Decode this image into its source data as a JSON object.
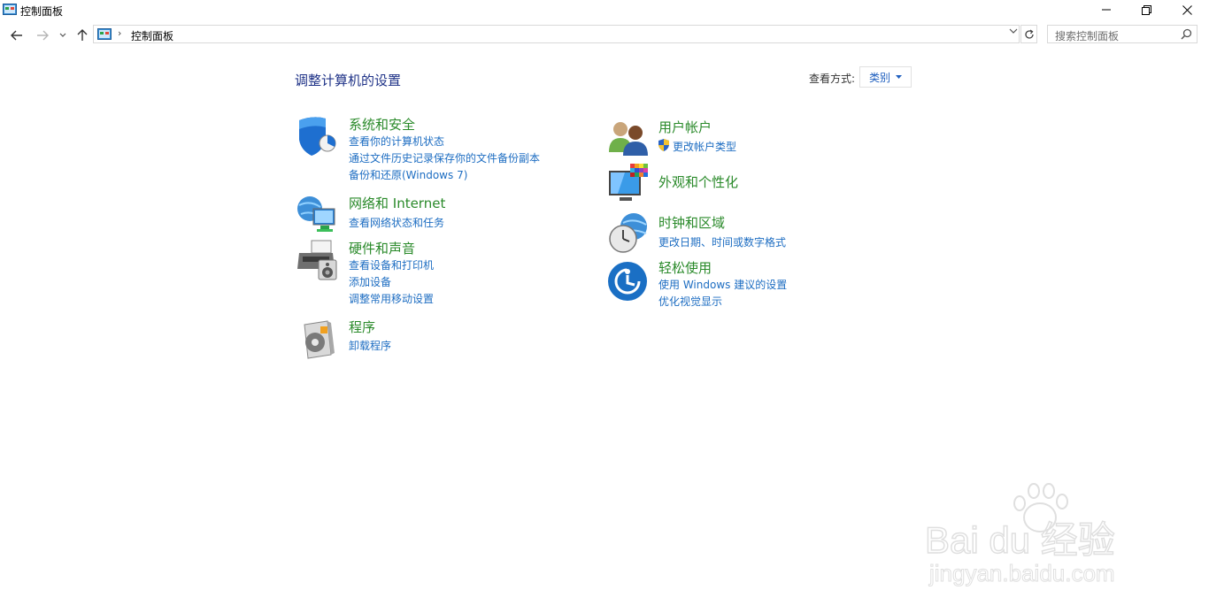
{
  "window": {
    "title": "控制面板",
    "minimize_icon": "minimize-icon",
    "restore_icon": "restore-icon",
    "close_icon": "close-icon"
  },
  "nav": {
    "back_icon": "back-arrow-icon",
    "forward_icon": "forward-arrow-icon",
    "recent_icon": "chevron-down-icon",
    "up_icon": "up-arrow-icon"
  },
  "address": {
    "path": "控制面板",
    "separator": "›",
    "refresh_icon": "refresh-icon"
  },
  "search": {
    "placeholder": "搜索控制面板"
  },
  "content": {
    "title": "调整计算机的设置",
    "view_by_label": "查看方式:",
    "view_by_value": "类别"
  },
  "categories": {
    "system": {
      "title": "系统和安全",
      "icon": "shield-icon",
      "links": [
        "查看你的计算机状态",
        "通过文件历史记录保存你的文件备份副本",
        "备份和还原(Windows 7)"
      ]
    },
    "network": {
      "title": "网络和 Internet",
      "icon": "network-globe-icon",
      "links": [
        "查看网络状态和任务"
      ]
    },
    "hardware": {
      "title": "硬件和声音",
      "icon": "printer-speaker-icon",
      "links": [
        "查看设备和打印机",
        "添加设备",
        "调整常用移动设置"
      ]
    },
    "programs": {
      "title": "程序",
      "icon": "programs-disc-icon",
      "links": [
        "卸载程序"
      ]
    },
    "users": {
      "title": "用户帐户",
      "icon": "users-icon",
      "links": [
        "更改帐户类型"
      ]
    },
    "appearance": {
      "title": "外观和个性化",
      "icon": "monitor-palette-icon",
      "links": []
    },
    "clock": {
      "title": "时钟和区域",
      "icon": "clock-globe-icon",
      "links": [
        "更改日期、时间或数字格式"
      ]
    },
    "ease": {
      "title": "轻松使用",
      "icon": "ease-of-access-icon",
      "links": [
        "使用 Windows 建议的设置",
        "优化视觉显示"
      ]
    }
  },
  "watermark": {
    "brand": "Bai du 经验",
    "url": "jingyan.baidu.com"
  }
}
